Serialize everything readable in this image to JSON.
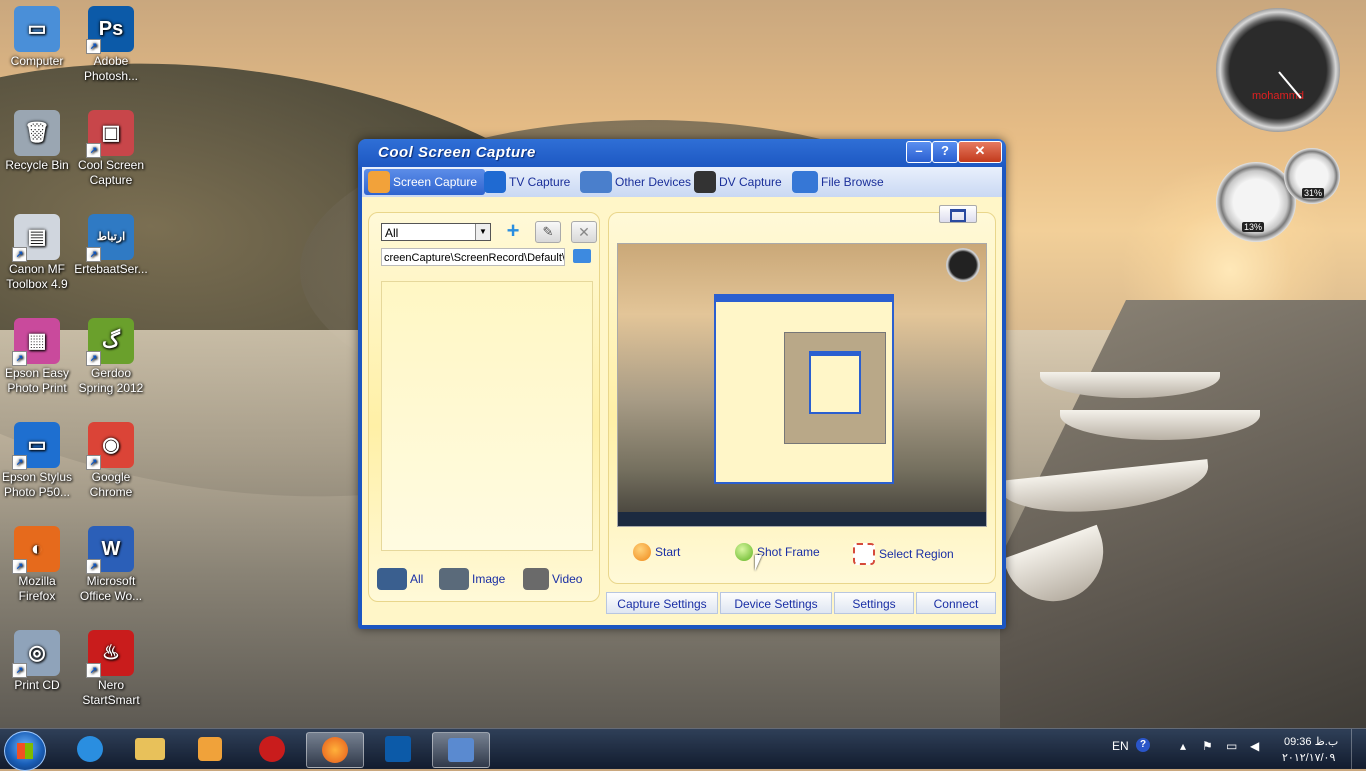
{
  "desktop": {
    "icons": [
      {
        "label1": "Computer",
        "label2": "",
        "color": "#4a8fd8",
        "glyph": "▭"
      },
      {
        "label1": "Adobe",
        "label2": "Photosh...",
        "color": "#0c5aa8",
        "glyph": "Ps"
      },
      {
        "label1": "Recycle Bin",
        "label2": "",
        "color": "#9aa6b2",
        "glyph": "🗑"
      },
      {
        "label1": "Cool Screen",
        "label2": "Capture",
        "color": "#c8464a",
        "glyph": "▣"
      },
      {
        "label1": "Canon MF",
        "label2": "Toolbox 4.9",
        "color": "#d0d6de",
        "glyph": "▤"
      },
      {
        "label1": "ErtebaatSer...",
        "label2": "",
        "color": "#2f7ac4",
        "glyph": "ارتباط"
      },
      {
        "label1": "Epson Easy",
        "label2": "Photo Print",
        "color": "#c94a9c",
        "glyph": "▦"
      },
      {
        "label1": "Gerdoo",
        "label2": "Spring 2012",
        "color": "#6aa02c",
        "glyph": "گ"
      },
      {
        "label1": "Epson Stylus",
        "label2": "Photo P50...",
        "color": "#1e6fd0",
        "glyph": "▭"
      },
      {
        "label1": "Google",
        "label2": "Chrome",
        "color": "#db4437",
        "glyph": "◉"
      },
      {
        "label1": "Mozilla",
        "label2": "Firefox",
        "color": "#e66a1c",
        "glyph": "◐"
      },
      {
        "label1": "Microsoft",
        "label2": "Office Wo...",
        "color": "#2b5fb8",
        "glyph": "W"
      },
      {
        "label1": "Print CD",
        "label2": "",
        "color": "#8fa3ba",
        "glyph": "◎"
      },
      {
        "label1": "Nero",
        "label2": "StartSmart",
        "color": "#c91c1c",
        "glyph": "♨"
      }
    ]
  },
  "gadgets": {
    "clock_label": "mohammd",
    "cpu_percent": "13%",
    "mem_percent": "31%"
  },
  "window": {
    "title": "Cool Screen Capture",
    "buttons": {
      "minimize": "–",
      "help": "?",
      "close": "✕"
    },
    "tabs": [
      {
        "label": "Screen Capture",
        "color": "#f2a23a"
      },
      {
        "label": "TV Capture",
        "color": "#1f6ad2"
      },
      {
        "label": "Other Devices",
        "color": "#4a7fcc"
      },
      {
        "label": "DV Capture",
        "color": "#333"
      },
      {
        "label": "File Browse",
        "color": "#3677d6"
      }
    ],
    "left_panel": {
      "filter_value": "All",
      "path_value": "creenCapture\\ScreenRecord\\Default\\",
      "filters": [
        {
          "label": "All"
        },
        {
          "label": "Image"
        },
        {
          "label": "Video"
        }
      ]
    },
    "right_panel": {
      "actions": [
        {
          "label": "Start",
          "color": "#f39a1a"
        },
        {
          "label": "Shot Frame",
          "color": "#7ccf3a"
        },
        {
          "label": "Select Region",
          "color": "#d64a3a"
        }
      ]
    },
    "bottom_buttons": [
      "Capture Settings",
      "Device Settings",
      "Settings",
      "Connect"
    ]
  },
  "taskbar": {
    "lang": "EN",
    "time": "09:36 ب.ظ",
    "date": "۲۰۱۲/۱۷/۰۹"
  }
}
